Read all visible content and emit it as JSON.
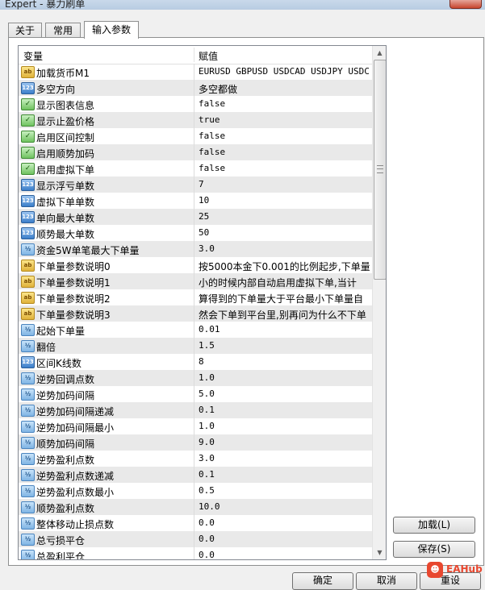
{
  "window": {
    "title": "Expert - 暴力刷单"
  },
  "tabs": [
    {
      "label": "关于"
    },
    {
      "label": "常用"
    },
    {
      "label": "输入参数"
    }
  ],
  "grid": {
    "header": {
      "name": "变量",
      "value": "赋值"
    },
    "rows": [
      {
        "type": "ab",
        "icon": "ab",
        "name": "加载货币M1",
        "value": "EURUSD GBPUSD USDCAD USDJPY USDC..."
      },
      {
        "type": "int",
        "icon": "123",
        "name": "多空方向",
        "value": "多空都做"
      },
      {
        "type": "bool",
        "icon": "✓",
        "name": "显示图表信息",
        "value": "false"
      },
      {
        "type": "bool",
        "icon": "✓",
        "name": "显示止盈价格",
        "value": "true"
      },
      {
        "type": "bool",
        "icon": "✓",
        "name": "启用区间控制",
        "value": "false"
      },
      {
        "type": "bool",
        "icon": "✓",
        "name": "启用顺势加码",
        "value": "false"
      },
      {
        "type": "bool",
        "icon": "✓",
        "name": "启用虚拟下单",
        "value": "false"
      },
      {
        "type": "int",
        "icon": "123",
        "name": "显示浮亏单数",
        "value": "7"
      },
      {
        "type": "int",
        "icon": "123",
        "name": "虚拟下单单数",
        "value": "10"
      },
      {
        "type": "int",
        "icon": "123",
        "name": "单向最大单数",
        "value": "25"
      },
      {
        "type": "int",
        "icon": "123",
        "name": "顺势最大单数",
        "value": "50"
      },
      {
        "type": "dbl",
        "icon": "½",
        "name": "资金5W单笔最大下单量",
        "value": "3.0"
      },
      {
        "type": "ab",
        "icon": "ab",
        "name": "下单量参数说明0",
        "value": "按5000本金下0.001的比例起步,下单量"
      },
      {
        "type": "ab",
        "icon": "ab",
        "name": "下单量参数说明1",
        "value": "小的时候内部自动启用虚拟下单,当计"
      },
      {
        "type": "ab",
        "icon": "ab",
        "name": "下单量参数说明2",
        "value": "算得到的下单量大于平台最小下单量自"
      },
      {
        "type": "ab",
        "icon": "ab",
        "name": "下单量参数说明3",
        "value": "然会下单到平台里,别再问为什么不下单"
      },
      {
        "type": "dbl",
        "icon": "½",
        "name": "起始下单量",
        "value": "0.01"
      },
      {
        "type": "dbl",
        "icon": "½",
        "name": "翻倍",
        "value": "1.5"
      },
      {
        "type": "int",
        "icon": "123",
        "name": "区间K线数",
        "value": "8"
      },
      {
        "type": "dbl",
        "icon": "½",
        "name": "逆势回调点数",
        "value": "1.0"
      },
      {
        "type": "dbl",
        "icon": "½",
        "name": "逆势加码间隔",
        "value": "5.0"
      },
      {
        "type": "dbl",
        "icon": "½",
        "name": "逆势加码间隔递减",
        "value": "0.1"
      },
      {
        "type": "dbl",
        "icon": "½",
        "name": "逆势加码间隔最小",
        "value": "1.0"
      },
      {
        "type": "dbl",
        "icon": "½",
        "name": "顺势加码间隔",
        "value": "9.0"
      },
      {
        "type": "dbl",
        "icon": "½",
        "name": "逆势盈利点数",
        "value": "3.0"
      },
      {
        "type": "dbl",
        "icon": "½",
        "name": "逆势盈利点数递减",
        "value": "0.1"
      },
      {
        "type": "dbl",
        "icon": "½",
        "name": "逆势盈利点数最小",
        "value": "0.5"
      },
      {
        "type": "dbl",
        "icon": "½",
        "name": "顺势盈利点数",
        "value": "10.0"
      },
      {
        "type": "dbl",
        "icon": "½",
        "name": "整体移动止损点数",
        "value": "0.0"
      },
      {
        "type": "dbl",
        "icon": "½",
        "name": "总亏损平仓",
        "value": "0.0"
      },
      {
        "type": "dbl",
        "icon": "½",
        "name": "总盈利平仓",
        "value": "0.0"
      }
    ]
  },
  "buttons": {
    "load": "加载(L)",
    "save": "保存(S)",
    "ok": "确定",
    "cancel": "取消",
    "reset": "重设"
  },
  "watermark": {
    "logo": "☻",
    "text": "EAHub"
  }
}
